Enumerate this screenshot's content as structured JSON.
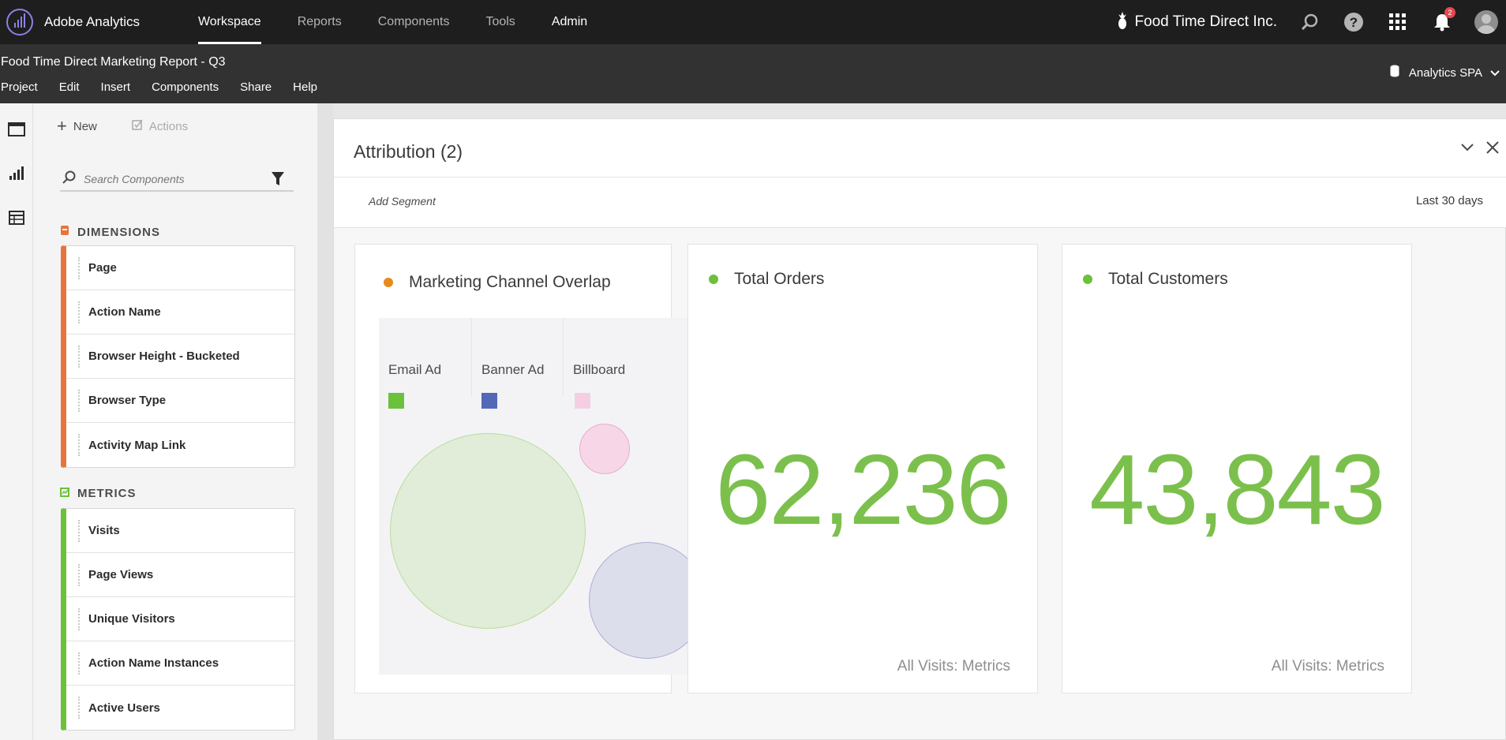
{
  "app": {
    "name": "Adobe Analytics",
    "nav": [
      "Workspace",
      "Reports",
      "Components",
      "Tools",
      "Admin"
    ],
    "active_nav": "Workspace",
    "company": "Food Time Direct Inc.",
    "notification_count": "2"
  },
  "project": {
    "title": "Food Time Direct Marketing Report - Q3",
    "menu": [
      "Project",
      "Edit",
      "Insert",
      "Components",
      "Share",
      "Help"
    ],
    "report_suite": "Analytics SPA"
  },
  "panel": {
    "new_label": "New",
    "actions_label": "Actions",
    "search_placeholder": "Search Components",
    "dimensions_heading": "DIMENSIONS",
    "dimensions": [
      "Page",
      "Action Name",
      "Browser Height - Bucketed",
      "Browser Type",
      "Activity Map Link"
    ],
    "metrics_heading": "METRICS",
    "metrics": [
      "Visits",
      "Page Views",
      "Unique Visitors",
      "Action Name Instances",
      "Active Users"
    ]
  },
  "workspace": {
    "title": "Attribution (2)",
    "add_segment": "Add Segment",
    "date_range": "Last 30 days",
    "venn": {
      "title": "Marketing Channel Overlap",
      "legend": [
        {
          "label": "Email Ad",
          "color": "#6bc13a"
        },
        {
          "label": "Banner Ad",
          "color": "#5468b8"
        },
        {
          "label": "Billboard",
          "color": "#f4cfe3"
        }
      ]
    },
    "kpi1": {
      "title": "Total Orders",
      "value": "62,236",
      "footer": "All Visits: Metrics"
    },
    "kpi2": {
      "title": "Total Customers",
      "value": "43,843",
      "footer": "All Visits: Metrics"
    }
  },
  "colors": {
    "accent_orange": "#e8743b",
    "accent_green": "#6bc13a",
    "kpi_green": "#7bc04c"
  }
}
